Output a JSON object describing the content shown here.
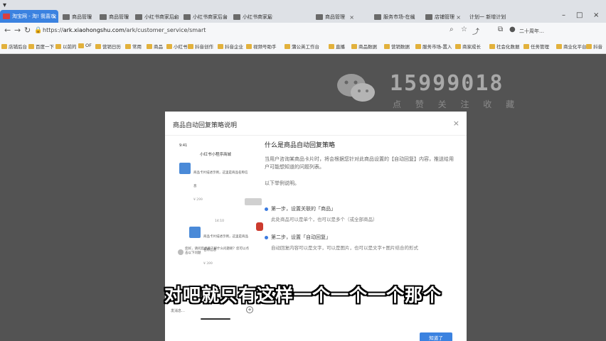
{
  "browser": {
    "tabs": [
      {
        "label": "淘宝网 - 淘! 我喜欢",
        "active": true
      },
      {
        "label": "商品管理"
      },
      {
        "label": "商品管理"
      },
      {
        "label": "小红书商家后台"
      },
      {
        "label": "小红书商家后台"
      },
      {
        "label": "小红书商家后台"
      },
      {
        "label": "商品管理"
      },
      {
        "label": "服务市场-在线"
      },
      {
        "label": "店铺管理"
      }
    ],
    "window_title": "计划一 新增计划",
    "address": {
      "scheme": "https://",
      "host": "ark.xiaohongshu.com",
      "path": "/ark/customer_service/smart"
    },
    "account_label": "二十周年…",
    "bookmarks": [
      "店铺后台",
      "百度一下",
      "以前的",
      "OF",
      "营销日历",
      "常用",
      "商品",
      "小红书",
      "抖音创作",
      "抖音企业",
      "视频号助手",
      "蒲公英工作台",
      "直播",
      "商品数据",
      "营销数据",
      "服务市场-置入",
      "商家成长",
      "社会化数据",
      "任务管理",
      "商业化平台",
      "抖音"
    ]
  },
  "watermark": {
    "number": "15999018",
    "subtitle": "点 赞 关 注 收 藏"
  },
  "dialog": {
    "title": "商品自动回复策略说明",
    "close": "×",
    "info_title": "什么是商品自动回复策略",
    "info_desc": "当用户咨询某商品卡片时，将会根据您针对此商品设置的【自动回复】内容，推送给用户可能想知道的问题列表。",
    "example_label": "以下举例说明。",
    "steps": [
      {
        "head": "第一步，设置关联的「商品」",
        "body": "此处商品可以是单个，也可以是多个（或全部商品）"
      },
      {
        "head": "第二步，设置「自动回复」",
        "body": "自动回复内容可以是文字，可以是图片，也可以是文字+图片结合的形式"
      }
    ],
    "confirm_button": "知道了",
    "phone": {
      "status_time": "9:41",
      "chat_title": "小红书小程序商城",
      "card1_text": "商品卡片描述示例，这里是商品名称信息",
      "card1_price": "¥ 299",
      "time_label": "14:10",
      "card2_text": "商品卡片描述示例，这里是商品名称信息",
      "card2_price": "¥ 399",
      "hint": "您好，请问您想要了解什么问题呢？您可以点击以下问题",
      "input_placeholder": "发消息…"
    }
  },
  "subtitle": "对吧就只有这样一个一个一个那个"
}
